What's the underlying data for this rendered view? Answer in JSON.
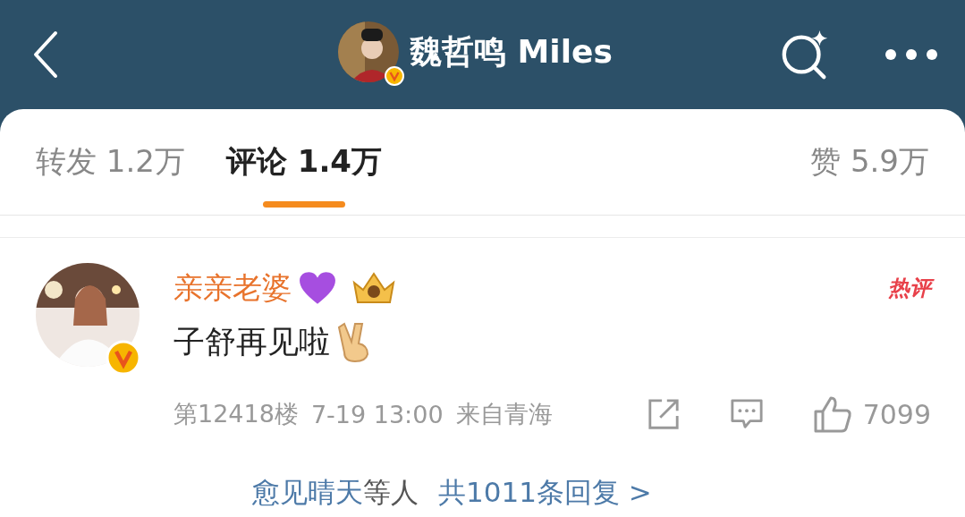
{
  "header": {
    "title": "魏哲鸣 Miles",
    "verified": true
  },
  "tabs": [
    {
      "label": "转发",
      "count": "1.2万",
      "selected": false
    },
    {
      "label": "评论",
      "count": "1.4万",
      "selected": true
    },
    {
      "label": "赞",
      "count": "5.9万",
      "selected": false
    }
  ],
  "comment": {
    "author": "亲亲老婆",
    "verified": true,
    "badge": "热评",
    "text": "子舒再见啦",
    "floor": "第12418楼",
    "time": "7-19 13:00",
    "location": "来自青海",
    "likes": "7099",
    "replies": {
      "names": "愈见晴天",
      "suffix": "等人",
      "summary": "共1011条回复 >"
    }
  }
}
